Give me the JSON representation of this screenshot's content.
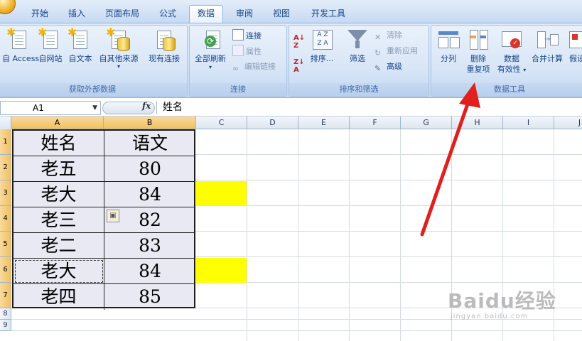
{
  "ribbon": {
    "tabs": [
      {
        "label": "开始"
      },
      {
        "label": "插入"
      },
      {
        "label": "页面布局"
      },
      {
        "label": "公式"
      },
      {
        "label": "数据",
        "active": true
      },
      {
        "label": "审阅"
      },
      {
        "label": "视图"
      },
      {
        "label": "开发工具"
      }
    ],
    "groups": {
      "external": {
        "label": "获取外部数据",
        "buttons": {
          "access": "自 Access",
          "web": "自网站",
          "text": "自文本",
          "other": "自其他来源",
          "existing": "现有连接"
        }
      },
      "connections": {
        "label": "连接",
        "refresh_all": "全部刷新",
        "connections": "连接",
        "properties": "属性",
        "edit_links": "编辑链接"
      },
      "sort_filter": {
        "label": "排序和筛选",
        "sort": "排序...",
        "filter": "筛选",
        "clear": "清除",
        "reapply": "重新应用",
        "advanced": "高级"
      },
      "data_tools": {
        "label": "数据工具",
        "text_to_columns": "分列",
        "remove_duplicates_line1": "删除",
        "remove_duplicates_line2": "重复项",
        "validation_line1": "数据",
        "validation_line2": "有效性",
        "consolidate": "合并计算",
        "what_if": "假设"
      }
    }
  },
  "formula_bar": {
    "name_box": "A1",
    "fx": "fx",
    "content": "姓名"
  },
  "grid": {
    "columns": [
      "A",
      "B",
      "C",
      "D",
      "E",
      "F",
      "G",
      "H",
      "I",
      "J"
    ],
    "rows": [
      "1",
      "2",
      "3",
      "4",
      "5",
      "6",
      "7",
      "8",
      "9"
    ],
    "table": {
      "header": [
        "姓名",
        "语文"
      ],
      "rows": [
        [
          "老五",
          "80"
        ],
        [
          "老大",
          "84"
        ],
        [
          "老三",
          "82"
        ],
        [
          "老二",
          "83"
        ],
        [
          "老大",
          "84"
        ],
        [
          "老四",
          "85"
        ]
      ]
    },
    "highlight_color": "#ffff00"
  },
  "watermark": {
    "main": "Baidu经验",
    "sub": "jingyan.baidu.com"
  },
  "annotation": {
    "arrow_color": "#e0201c"
  }
}
